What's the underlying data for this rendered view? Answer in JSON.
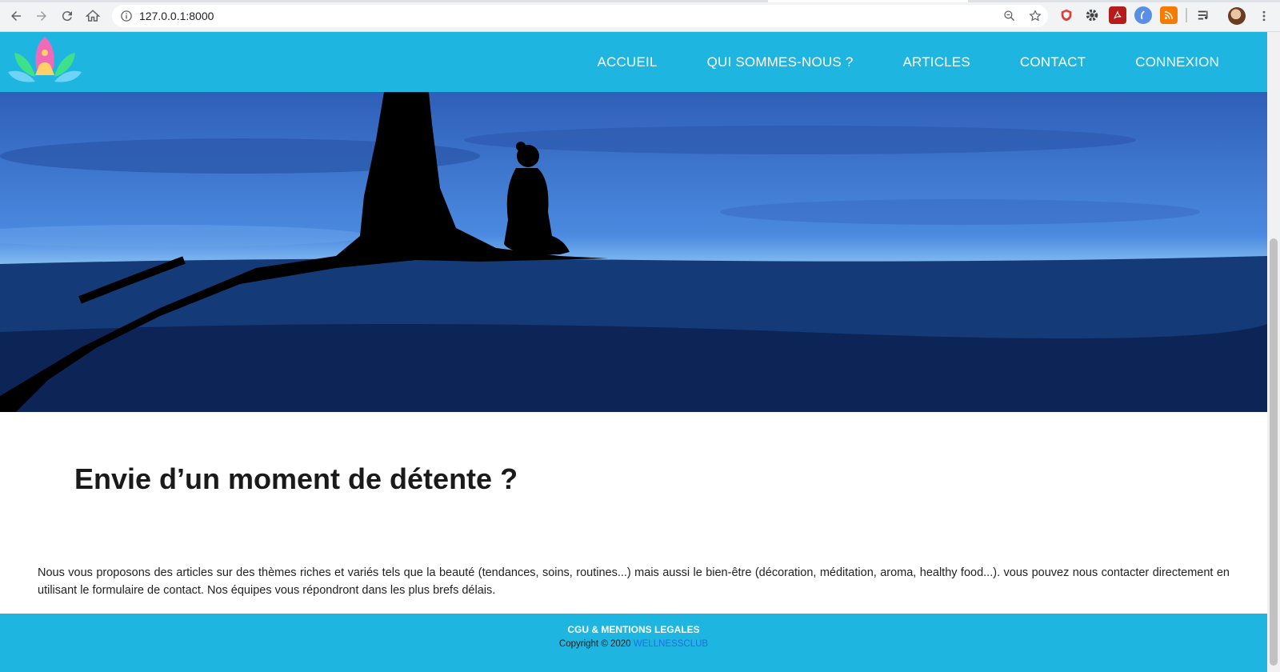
{
  "browser": {
    "url": "127.0.0.1:8000",
    "icons": [
      "back-icon",
      "forward-icon",
      "reload-icon",
      "home-icon",
      "info-icon",
      "zoom-icon",
      "star-icon",
      "shield-extension-icon",
      "gear-extension-icon",
      "pdf-extension-icon",
      "blue-extension-icon",
      "rss-extension-icon",
      "media-control-icon",
      "profile-avatar",
      "menu-kebab-icon"
    ]
  },
  "header": {
    "nav": [
      {
        "label": "ACCUEIL"
      },
      {
        "label": "QUI SOMMES-NOUS ?"
      },
      {
        "label": "ARTICLES"
      },
      {
        "label": "CONTACT"
      },
      {
        "label": "CONNEXION"
      }
    ]
  },
  "main": {
    "title": "Envie d’un moment de détente ?",
    "paragraph": "Nous vous proposons des articles sur des thèmes riches et variés tels que la beauté (tendances, soins, routines...) mais aussi le bien-être (décoration, méditation, aroma, healthy food...). vous pouvez nous contacter directement en utilisant le formulaire de contact. Nos équipes vous répondront dans les plus brefs délais."
  },
  "footer": {
    "links_label": "CGU & MENTIONS LEGALES",
    "copyright_prefix": "Copyright © 2020",
    "brand": "WELLNESSCLUB"
  },
  "colors": {
    "brand_blue": "#1eb6e0",
    "hero_sky": "#3f7fd6",
    "hero_water": "#0b2450",
    "link_blue": "#1e6fe0"
  }
}
